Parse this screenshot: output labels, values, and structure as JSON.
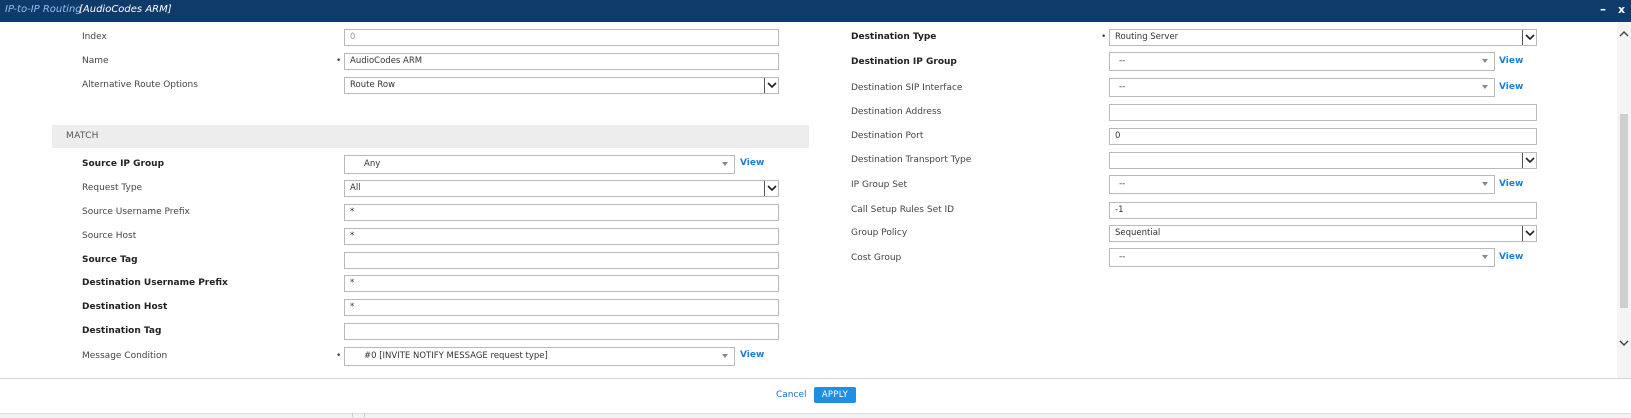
{
  "window": {
    "title_main": "IP-to-IP Routing",
    "title_sub": "[AudioCodes ARM]",
    "minimize": "–",
    "close": "x"
  },
  "general": {
    "index_label": "Index",
    "index_value": "0",
    "name_label": "Name",
    "name_value": "AudioCodes ARM",
    "alt_route_label": "Alternative Route Options",
    "alt_route_value": "Route Row"
  },
  "match": {
    "section_title": "MATCH",
    "source_ip_group_label": "Source IP Group",
    "source_ip_group_value": "Any",
    "request_type_label": "Request Type",
    "request_type_value": "All",
    "source_username_prefix_label": "Source Username Prefix",
    "source_username_prefix_value": "*",
    "source_host_label": "Source Host",
    "source_host_value": "*",
    "source_tag_label": "Source Tag",
    "source_tag_value": "",
    "dest_username_prefix_label": "Destination Username Prefix",
    "dest_username_prefix_value": "*",
    "dest_host_label": "Destination Host",
    "dest_host_value": "*",
    "dest_tag_label": "Destination Tag",
    "dest_tag_value": "",
    "message_condition_label": "Message Condition",
    "message_condition_value": "#0 [INVITE NOTIFY MESSAGE request type]"
  },
  "action": {
    "dest_type_label": "Destination Type",
    "dest_type_value": "Routing Server",
    "dest_ip_group_label": "Destination IP Group",
    "dest_ip_group_value": "--",
    "dest_sip_interface_label": "Destination SIP Interface",
    "dest_sip_interface_value": "--",
    "dest_address_label": "Destination Address",
    "dest_address_value": "",
    "dest_port_label": "Destination Port",
    "dest_port_value": "0",
    "dest_transport_label": "Destination Transport Type",
    "dest_transport_value": "",
    "ip_group_set_label": "IP Group Set",
    "ip_group_set_value": "--",
    "call_setup_label": "Call Setup Rules Set ID",
    "call_setup_value": "-1",
    "group_policy_label": "Group Policy",
    "group_policy_value": "Sequential",
    "cost_group_label": "Cost Group",
    "cost_group_value": "--"
  },
  "common": {
    "required_mark": "•",
    "view_link": "View"
  },
  "footer": {
    "cancel_label": "Cancel",
    "apply_label": "APPLY"
  },
  "colors": {
    "titlebar": "#0f3b6b",
    "link": "#1b7fd4",
    "apply": "#1e8fe3"
  }
}
